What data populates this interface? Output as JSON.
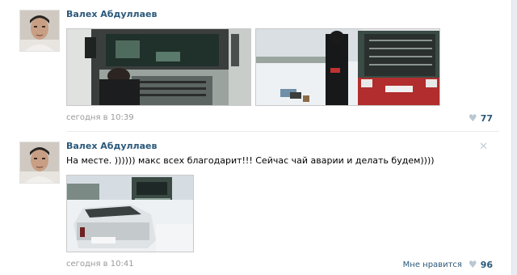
{
  "posts": [
    {
      "author": "Валех Абдуллаев",
      "text": "",
      "date": "сегодня в 10:39",
      "likes_label": "",
      "likes_count": "77",
      "heart_icon": "heart-icon"
    },
    {
      "author": "Валех Абдуллаев",
      "text": "На месте. )))))) макс всех благодарит!!! Сейчас чай аварии и делать будем))))",
      "date": "сегодня в 10:41",
      "likes_label": "Мне нравится",
      "likes_count": "96",
      "heart_icon": "heart-icon",
      "close_icon": "close-icon"
    }
  ]
}
